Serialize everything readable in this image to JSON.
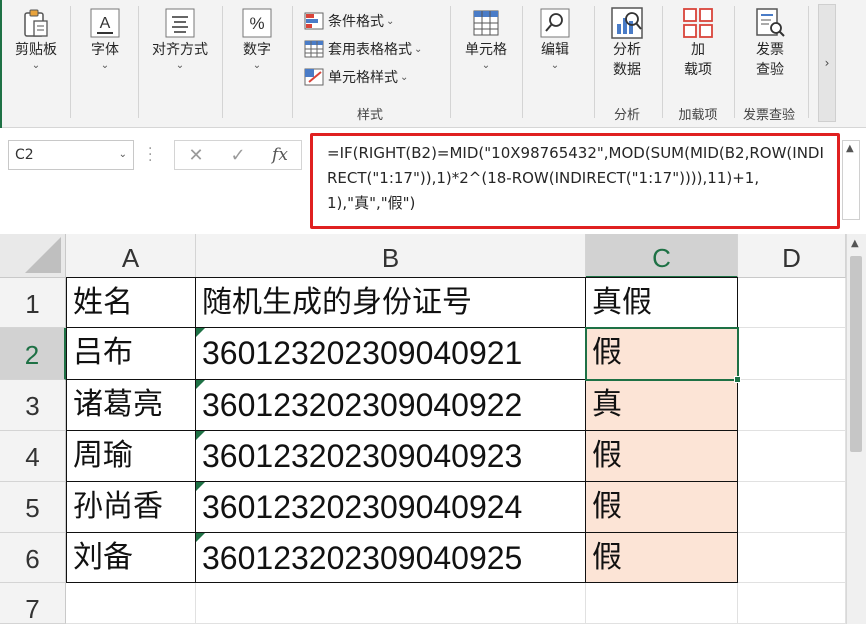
{
  "ribbon": {
    "paste": {
      "label": "剪贴板"
    },
    "font": {
      "label": "字体"
    },
    "align": {
      "label": "对齐方式"
    },
    "number": {
      "label": "数字"
    },
    "styles": {
      "conditional": "条件格式",
      "table": "套用表格格式",
      "cell_style": "单元格样式",
      "group_label": "样式"
    },
    "cells": {
      "label": "单元格"
    },
    "edit": {
      "label": "编辑"
    },
    "analyze": {
      "line1": "分析",
      "line2": "数据",
      "group_label": "分析"
    },
    "addins": {
      "line1": "加",
      "line2": "载项",
      "group_label": "加载项"
    },
    "invoice": {
      "line1": "发票",
      "line2": "查验",
      "group_label": "发票查验"
    },
    "scroll": "›",
    "chevron": "⌄"
  },
  "formula_bar": {
    "name_box": "C2",
    "cancel": "✕",
    "confirm": "✓",
    "fx": "fx",
    "formula": "=IF(RIGHT(B2)=MID(\"10X98765432\",MOD(SUM(MID(B2,ROW(INDIRECT(\"1:17\")),1)*2^(18-ROW(INDIRECT(\"1:17\")))),11)+1,1),\"真\",\"假\")"
  },
  "sheet": {
    "columns": [
      "A",
      "B",
      "C",
      "D"
    ],
    "rows": [
      "1",
      "2",
      "3",
      "4",
      "5",
      "6",
      "7"
    ],
    "header": {
      "name": "姓名",
      "id": "随机生成的身份证号",
      "check": "真假"
    },
    "data": [
      {
        "name": "吕布",
        "id": "360123202309040921",
        "check": "假"
      },
      {
        "name": "诸葛亮",
        "id": "360123202309040922",
        "check": "真"
      },
      {
        "name": "周瑜",
        "id": "360123202309040923",
        "check": "假"
      },
      {
        "name": "孙尚香",
        "id": "360123202309040924",
        "check": "假"
      },
      {
        "name": "刘备",
        "id": "360123202309040925",
        "check": "假"
      }
    ],
    "active_cell": "C2"
  },
  "colors": {
    "excel_green": "#1e7145",
    "highlight_red": "#e02020",
    "cell_pink": "#fce4d6"
  }
}
